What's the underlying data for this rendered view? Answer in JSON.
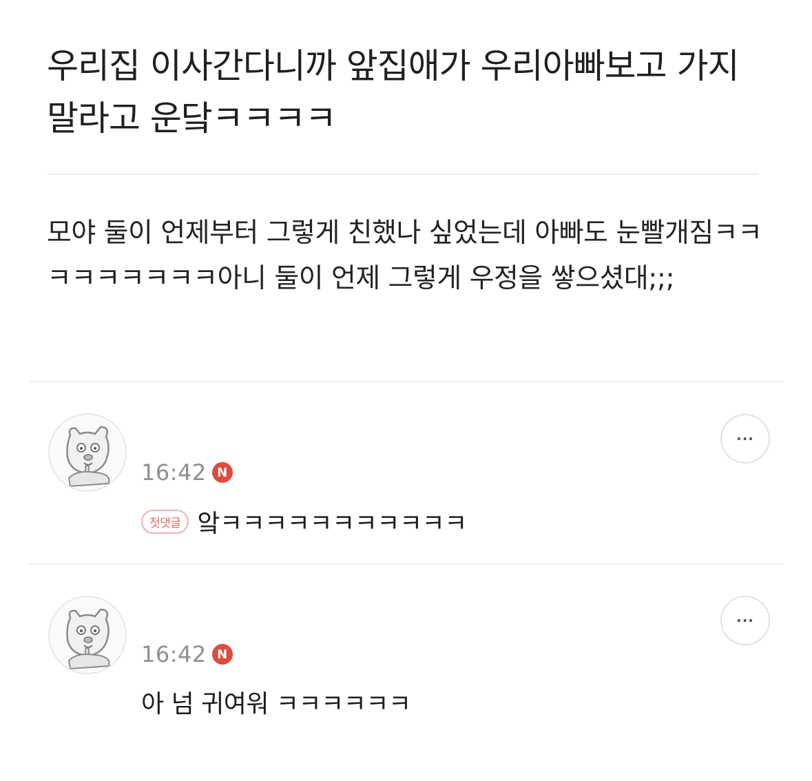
{
  "post": {
    "title": "우리집 이사간다니까 앞집애가 우리아빠보고 가지말라고 운닼ㅋㅋㅋㅋ",
    "body": "모야 둘이 언제부터 그렇게 친했나 싶었는데 아빠도 눈빨개짐ㅋㅋㅋㅋㅋㅋㅋㅋㅋ아니 둘이 언제 그렇게 우정을 쌓으셨대;;;"
  },
  "comments": [
    {
      "time": "16:42",
      "new_badge": "N",
      "first_comment_badge": "첫댓글",
      "text": "앜ㅋㅋㅋㅋㅋㅋㅋㅋㅋㅋㅋ",
      "more_label": "···",
      "avatar_icon": "dog-character-icon"
    },
    {
      "time": "16:42",
      "new_badge": "N",
      "text": "아 넘 귀여워 ㅋㅋㅋㅋㅋㅋ",
      "more_label": "···",
      "avatar_icon": "dog-character-icon"
    }
  ],
  "colors": {
    "new_badge": "#e04a3f",
    "first_comment_badge": "#e06a6a",
    "time_text": "#8e8e8e"
  }
}
